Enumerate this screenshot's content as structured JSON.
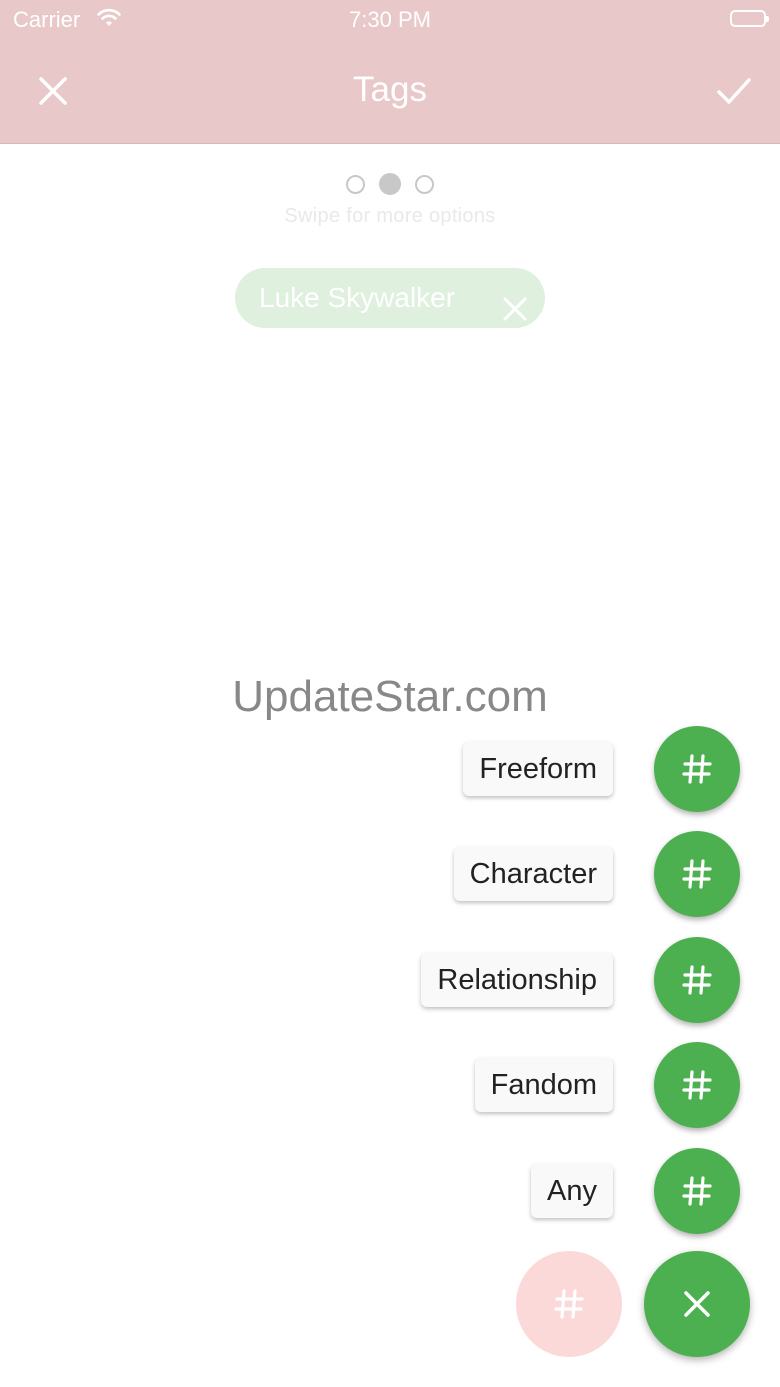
{
  "status_bar": {
    "carrier": "Carrier",
    "time": "7:30 PM"
  },
  "nav": {
    "title": "Tags",
    "close_icon": "close-icon",
    "done_icon": "check-icon"
  },
  "pager": {
    "dots": 3,
    "active_index": 1,
    "hint": "Swipe for more options"
  },
  "tags": [
    {
      "label": "Luke Skywalker"
    }
  ],
  "watermark": "UpdateStar.com",
  "fab_menu": {
    "items": [
      {
        "label": "Freeform",
        "icon": "hash-icon"
      },
      {
        "label": "Character",
        "icon": "hash-icon"
      },
      {
        "label": "Relationship",
        "icon": "hash-icon"
      },
      {
        "label": "Fandom",
        "icon": "hash-icon"
      },
      {
        "label": "Any",
        "icon": "hash-icon"
      }
    ],
    "main_icon": "close-icon",
    "faded_icon": "hash-icon"
  },
  "colors": {
    "header": "#e8c8c8",
    "fab_green": "#4caf50",
    "chip_bg": "#dff0df",
    "faded_fab": "#fcd9d9"
  }
}
